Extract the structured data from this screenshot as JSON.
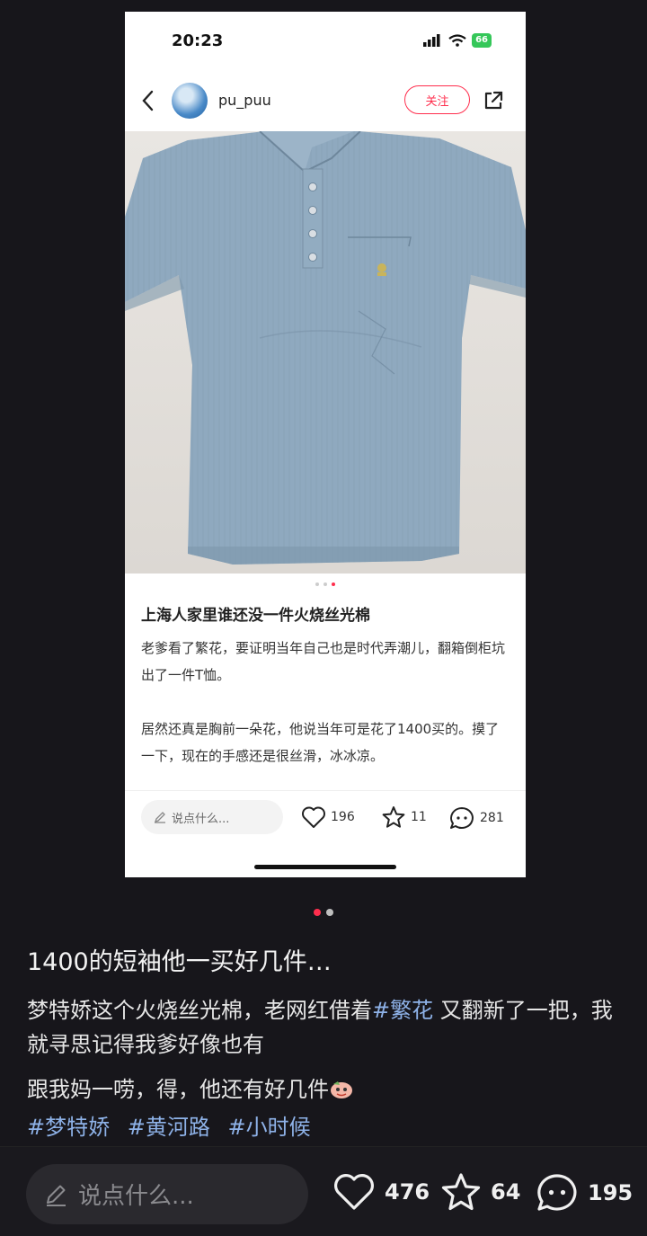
{
  "inner_post": {
    "status_time": "20:23",
    "battery": "66",
    "username": "pu_puu",
    "follow_label": "关注",
    "title": "上海人家里谁还没一件火烧丝光棉",
    "body_paragraphs": [
      "老爹看了繁花，要证明当年自己也是时代弄潮儿，翻箱倒柜坑出了一件T恤。",
      "居然还真是胸前一朵花，他说当年可是花了1400买的。摸了一下，现在的手感还是很丝滑，冰冰凉。"
    ],
    "comment_placeholder": "说点什么...",
    "likes": "196",
    "stars": "11",
    "comments": "281",
    "image_dots": 3,
    "active_image_dot": 3,
    "colors": {
      "accent": "#ff2e4d",
      "shirt": "#8fa9bf"
    }
  },
  "post": {
    "title": "1400的短袖他一买好几件…",
    "body_line1_before_tag": "梦特娇这个火烧丝光棉，老网红借着",
    "inline_tag": "#繁花",
    "body_line1_after_tag": "又翻新了一把，我就寻思记得我爹好像也有",
    "body_line2": "跟我妈一唠，得，他还有好几件",
    "tags": [
      "#梦特娇",
      "#黄河路",
      "#小时候"
    ],
    "image_dots": 2,
    "active_image_dot": 1
  },
  "bottom_bar": {
    "comment_placeholder": "说点什么...",
    "likes": "476",
    "stars": "64",
    "comments": "195"
  },
  "icons": [
    "chevron-left-icon",
    "share-icon",
    "pencil-icon",
    "heart-icon",
    "star-icon",
    "comment-icon",
    "signal-icon",
    "wifi-icon",
    "emoji-icon"
  ]
}
